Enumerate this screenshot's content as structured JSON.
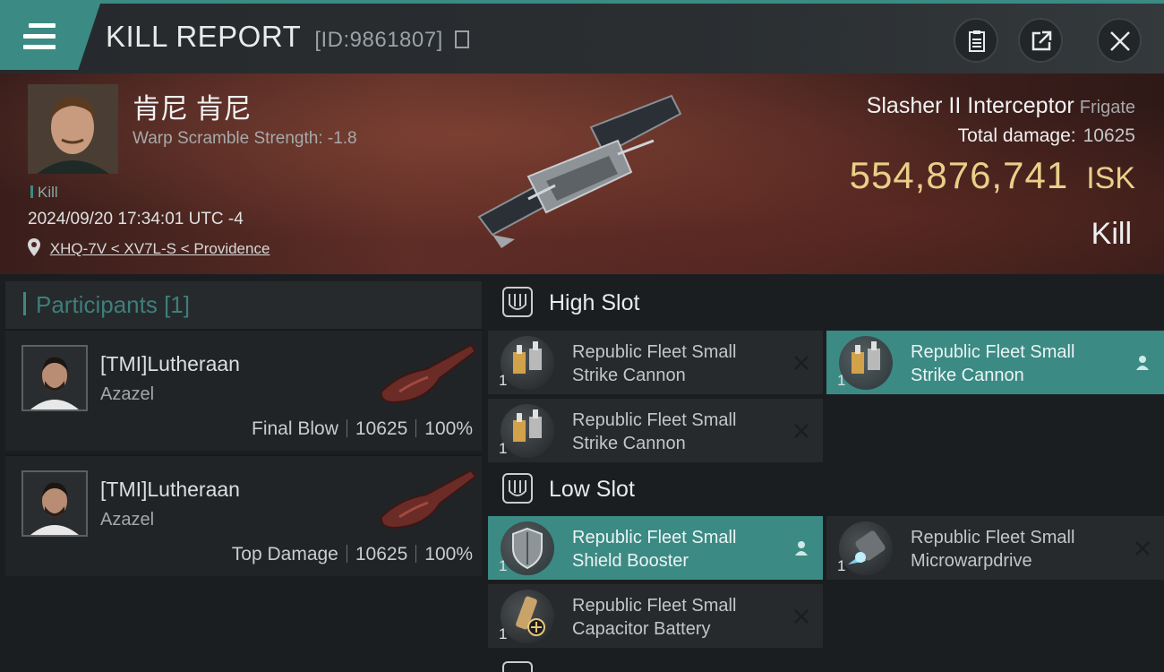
{
  "header": {
    "title": "KILL REPORT",
    "report_id": "[ID:9861807]",
    "icons": [
      "menu-icon",
      "copy-icon",
      "clipboard-icon",
      "share-icon",
      "close-icon"
    ]
  },
  "victim": {
    "name": "肯尼 肯尼",
    "warp_scramble": "Warp Scramble Strength: -1.8",
    "tag": "Kill",
    "timestamp": "2024/09/20 17:34:01 UTC -4",
    "location": "XHQ-7V < XV7L-S < Providence"
  },
  "ship": {
    "name": "Slasher II Interceptor",
    "class": "Frigate",
    "damage_label": "Total damage:",
    "damage_value": "10625",
    "isk_value": "554,876,741",
    "isk_unit": "ISK",
    "result": "Kill"
  },
  "participants": {
    "title": "Participants [1]",
    "rows": [
      {
        "name": "[TMI]Lutheraan",
        "ship": "Azazel",
        "role": "Final Blow",
        "damage": "10625",
        "percent": "100%"
      },
      {
        "name": "[TMI]Lutheraan",
        "ship": "Azazel",
        "role": "Top Damage",
        "damage": "10625",
        "percent": "100%"
      }
    ]
  },
  "fitting": {
    "high_slot": {
      "title": "High Slot",
      "modules": [
        {
          "line1": "Republic Fleet Small",
          "line2": "Strike Cannon",
          "qty": "1",
          "state": "destroyed",
          "action_icon": "close-icon"
        },
        {
          "line1": "Republic Fleet Small",
          "line2": "Strike Cannon",
          "qty": "1",
          "state": "dropped",
          "action_icon": "person-icon"
        },
        {
          "line1": "Republic Fleet Small",
          "line2": "Strike Cannon",
          "qty": "1",
          "state": "destroyed",
          "action_icon": "close-icon"
        }
      ]
    },
    "low_slot": {
      "title": "Low Slot",
      "modules": [
        {
          "line1": "Republic Fleet Small",
          "line2": "Shield Booster",
          "qty": "1",
          "state": "dropped",
          "action_icon": "person-icon"
        },
        {
          "line1": "Republic Fleet Small",
          "line2": "Microwarpdrive",
          "qty": "1",
          "state": "destroyed",
          "action_icon": "close-icon"
        },
        {
          "line1": "Republic Fleet Small",
          "line2": "Capacitor Battery",
          "qty": "1",
          "state": "destroyed",
          "action_icon": "close-icon"
        }
      ]
    }
  },
  "colors": {
    "accent": "#3c8a84",
    "isk": "#e9cf8a",
    "panel": "#262a2d"
  }
}
